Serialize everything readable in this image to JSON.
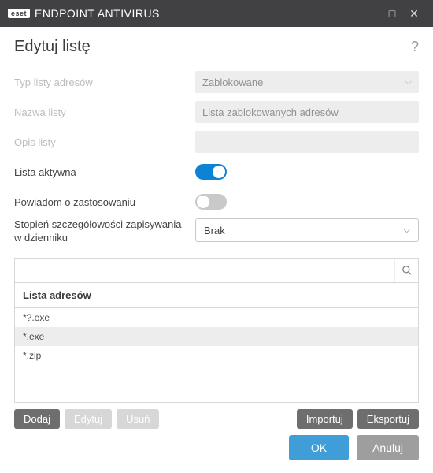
{
  "titlebar": {
    "brand": "eset",
    "product": "ENDPOINT ANTIVIRUS"
  },
  "page": {
    "title": "Edytuj listę",
    "help": "?"
  },
  "form": {
    "type_label": "Typ listy adresów",
    "type_value": "Zablokowane",
    "name_label": "Nazwa listy",
    "name_value": "Lista zablokowanych adresów",
    "desc_label": "Opis listy",
    "desc_value": "",
    "active_label": "Lista aktywna",
    "notify_label": "Powiadom o zastosowaniu",
    "log_label": "Stopień szczegółowości zapisywania w dzienniku",
    "log_value": "Brak"
  },
  "list": {
    "header": "Lista adresów",
    "items": [
      {
        "text": "*?.exe",
        "selected": false
      },
      {
        "text": "*.exe",
        "selected": true
      },
      {
        "text": "*.zip",
        "selected": false
      }
    ],
    "search_placeholder": ""
  },
  "buttons": {
    "add": "Dodaj",
    "edit": "Edytuj",
    "delete": "Usuń",
    "import": "Importuj",
    "export": "Eksportuj"
  },
  "footer": {
    "ok": "OK",
    "cancel": "Anuluj"
  }
}
